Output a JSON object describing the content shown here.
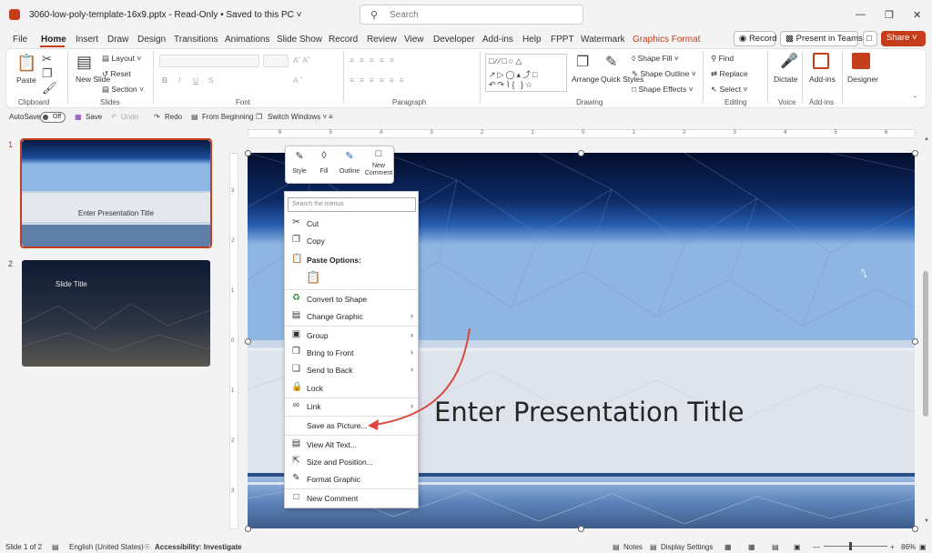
{
  "titlebar": {
    "doc_title": "3060-low-poly-template-16x9.pptx  -  Read-Only  •  Saved to this PC ˅",
    "search_placeholder": "Search"
  },
  "tabs": [
    "File",
    "Home",
    "Insert",
    "Draw",
    "Design",
    "Transitions",
    "Animations",
    "Slide Show",
    "Record",
    "Review",
    "View",
    "Developer",
    "Add-ins",
    "Help",
    "FPPT",
    "Watermark",
    "Graphics Format"
  ],
  "header_buttons": {
    "record": "Record",
    "present": "Present in Teams",
    "share": "Share ˅"
  },
  "ribbon": {
    "clipboard": {
      "paste": "Paste",
      "group": "Clipboard"
    },
    "slides": {
      "new_slide": "New Slide",
      "layout": "Layout ˅",
      "reset": "Reset",
      "section": "Section ˅",
      "group": "Slides"
    },
    "font_group": "Font",
    "paragraph_group": "Paragraph",
    "drawing": {
      "arrange": "Arrange",
      "quick_styles": "Quick Styles",
      "shape_fill": "Shape Fill ˅",
      "shape_outline": "Shape Outline ˅",
      "shape_effects": "Shape Effects ˅",
      "group": "Drawing"
    },
    "editing": {
      "find": "Find",
      "replace": "Replace",
      "select": "Select ˅",
      "group": "Editing"
    },
    "voice": {
      "dictate": "Dictate",
      "group": "Voice"
    },
    "addins": {
      "addins": "Add-ins",
      "group": "Add-ins"
    },
    "designer": "Designer"
  },
  "qat": {
    "autosave": "AutoSave",
    "off": "Off",
    "save": "Save",
    "undo": "Undo",
    "redo": "Redo",
    "from_beginning": "From Beginning",
    "switch_windows": "Switch Windows ˅"
  },
  "thumbnails": [
    {
      "num": "1",
      "title": "Enter Presentation Title"
    },
    {
      "num": "2",
      "title": "Slide Title"
    }
  ],
  "hruler_ticks": [
    "6",
    "5",
    "4",
    "3",
    "2",
    "1",
    "0",
    "1",
    "2",
    "3",
    "4",
    "5",
    "6"
  ],
  "vruler_ticks": [
    "3",
    "2",
    "1",
    "0",
    "1",
    "2",
    "3"
  ],
  "slide": {
    "title": "Enter Presentation Title"
  },
  "mini_toolbar": {
    "style": "Style",
    "fill": "Fill",
    "outline": "Outline",
    "new_comment": "New Comment"
  },
  "context_menu": {
    "search_placeholder": "Search the menus",
    "items": [
      {
        "label": "Cut",
        "icon": "scissors-icon"
      },
      {
        "label": "Copy",
        "icon": "copy-icon"
      },
      {
        "label": "Paste Options:",
        "icon": "paste-icon"
      },
      {
        "label": "Convert to Shape",
        "icon": "convert-shape-icon"
      },
      {
        "label": "Change Graphic",
        "icon": "change-graphic-icon",
        "submenu": true
      },
      {
        "label": "Group",
        "icon": "group-icon",
        "submenu": true
      },
      {
        "label": "Bring to Front",
        "icon": "bring-front-icon",
        "submenu": true
      },
      {
        "label": "Send to Back",
        "icon": "send-back-icon",
        "submenu": true
      },
      {
        "label": "Lock",
        "icon": "lock-icon"
      },
      {
        "label": "Link",
        "icon": "link-icon",
        "submenu": true
      },
      {
        "label": "Save as Picture...",
        "icon": ""
      },
      {
        "label": "View Alt Text...",
        "icon": "alt-text-icon"
      },
      {
        "label": "Size and Position...",
        "icon": "size-position-icon"
      },
      {
        "label": "Format Graphic",
        "icon": "format-graphic-icon"
      },
      {
        "label": "New Comment",
        "icon": "comment-icon"
      }
    ]
  },
  "status": {
    "slide": "Slide 1 of 2",
    "language": "English (United States)",
    "accessibility": "Accessibility: Investigate",
    "notes": "Notes",
    "display": "Display Settings",
    "zoom": "86%"
  },
  "colors": {
    "accent": "#c43e1c",
    "annotation_arrow": "#d9473f"
  }
}
